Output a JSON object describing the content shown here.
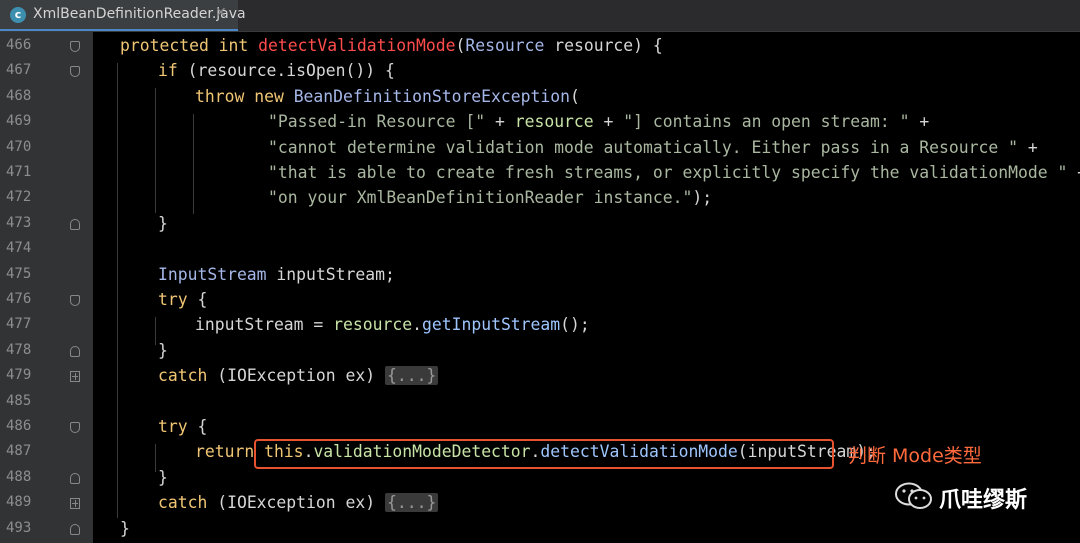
{
  "tab": {
    "icon_letter": "c",
    "title": "XmlBeanDefinitionReader.java",
    "close": "✕"
  },
  "lines": [
    {
      "num": "466",
      "fold": "open"
    },
    {
      "num": "467",
      "fold": "open"
    },
    {
      "num": "468",
      "fold": ""
    },
    {
      "num": "469",
      "fold": ""
    },
    {
      "num": "470",
      "fold": ""
    },
    {
      "num": "471",
      "fold": ""
    },
    {
      "num": "472",
      "fold": ""
    },
    {
      "num": "473",
      "fold": "close"
    },
    {
      "num": "474",
      "fold": ""
    },
    {
      "num": "475",
      "fold": ""
    },
    {
      "num": "476",
      "fold": "open"
    },
    {
      "num": "477",
      "fold": ""
    },
    {
      "num": "478",
      "fold": "close"
    },
    {
      "num": "479",
      "fold": "plus"
    },
    {
      "num": "485",
      "fold": ""
    },
    {
      "num": "486",
      "fold": "open"
    },
    {
      "num": "487",
      "fold": ""
    },
    {
      "num": "488",
      "fold": "close"
    },
    {
      "num": "489",
      "fold": "plus"
    },
    {
      "num": "493",
      "fold": "close"
    }
  ],
  "code": {
    "l466": {
      "kw1": "protected int ",
      "fn": "detectValidationMode",
      "p1": "(",
      "ty": "Resource",
      "rest": " resource) {"
    },
    "l467": {
      "kw": "if",
      "rest": " (resource.isOpen()) {"
    },
    "l468": {
      "kw": "throw new ",
      "ty": "BeanDefinitionStoreException",
      "rest": "("
    },
    "l469": {
      "s1": "\"Passed-in Resource [\"",
      "op1": " + ",
      "id": "resource",
      "op2": " + ",
      "s2": "\"] contains an open stream: \"",
      "op3": " +"
    },
    "l470": {
      "s": "\"cannot determine validation mode automatically. Either pass in a Resource \"",
      "op": " +"
    },
    "l471": {
      "s": "\"that is able to create fresh streams, or explicitly specify the validationMode \"",
      "op": " +"
    },
    "l472": {
      "s": "\"on your XmlBeanDefinitionReader instance.\"",
      "rest": ");"
    },
    "l473": {
      "rest": "}"
    },
    "l475": {
      "ty": "InputStream",
      "rest": " inputStream;"
    },
    "l476": {
      "kw": "try",
      "rest": " {"
    },
    "l477": {
      "a": "inputStream",
      "b": " = ",
      "c": "resource",
      "d": ".",
      "e": "getInputStream",
      "f": "();"
    },
    "l478": {
      "rest": "}"
    },
    "l479": {
      "kw": "catch",
      "rest": " (IOException ex) ",
      "folded": "{...}"
    },
    "l486": {
      "kw": "try",
      "rest": " {"
    },
    "l487": {
      "kw": "return ",
      "kw2": "this",
      "dot1": ".",
      "fld": "validationModeDetector",
      "dot2": ".",
      "call": "detectValidationMode",
      "args": "(inputStream);"
    },
    "l488": {
      "rest": "}"
    },
    "l489": {
      "kw": "catch",
      "rest": " (IOException ex) ",
      "folded": "{...}"
    },
    "l493": {
      "rest": "}"
    }
  },
  "annotation": "判断 Mode类型",
  "watermark": "爪哇缪斯",
  "colors": {
    "highlight_border": "#e8532f",
    "annotation": "#ff6a3d",
    "keyword": "#f0c674",
    "method_name": "#ff4c4c"
  }
}
